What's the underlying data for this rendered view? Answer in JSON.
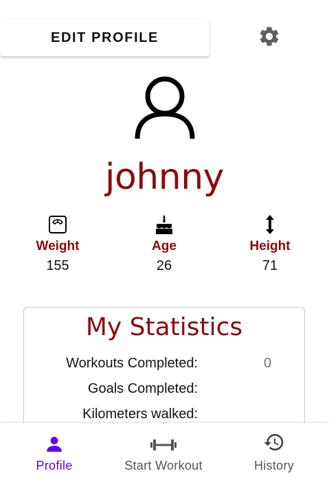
{
  "header": {
    "edit_profile_label": "EDIT PROFILE",
    "settings_icon": "gear-icon"
  },
  "profile": {
    "avatar_icon": "person-outline-icon",
    "username": "johnny"
  },
  "stats": [
    {
      "icon": "scale-icon",
      "label": "Weight",
      "value": "155"
    },
    {
      "icon": "cake-icon",
      "label": "Age",
      "value": "26"
    },
    {
      "icon": "vertical-arrows-icon",
      "label": "Height",
      "value": "71"
    }
  ],
  "statistics": {
    "title": "My Statistics",
    "rows": [
      {
        "label": "Workouts Completed:",
        "value": "0"
      },
      {
        "label": "Goals Completed:",
        "value": ""
      },
      {
        "label": "Kilometers walked:",
        "value": ""
      }
    ]
  },
  "bottom_nav": {
    "items": [
      {
        "label": "Profile",
        "icon": "person-icon",
        "active": true
      },
      {
        "label": "Start Workout",
        "icon": "dumbbell-icon",
        "active": false
      },
      {
        "label": "History",
        "icon": "history-icon",
        "active": false
      }
    ]
  },
  "colors": {
    "accent": "#8b0a0a",
    "nav_active": "#6200ee",
    "nav_inactive": "#555555"
  }
}
